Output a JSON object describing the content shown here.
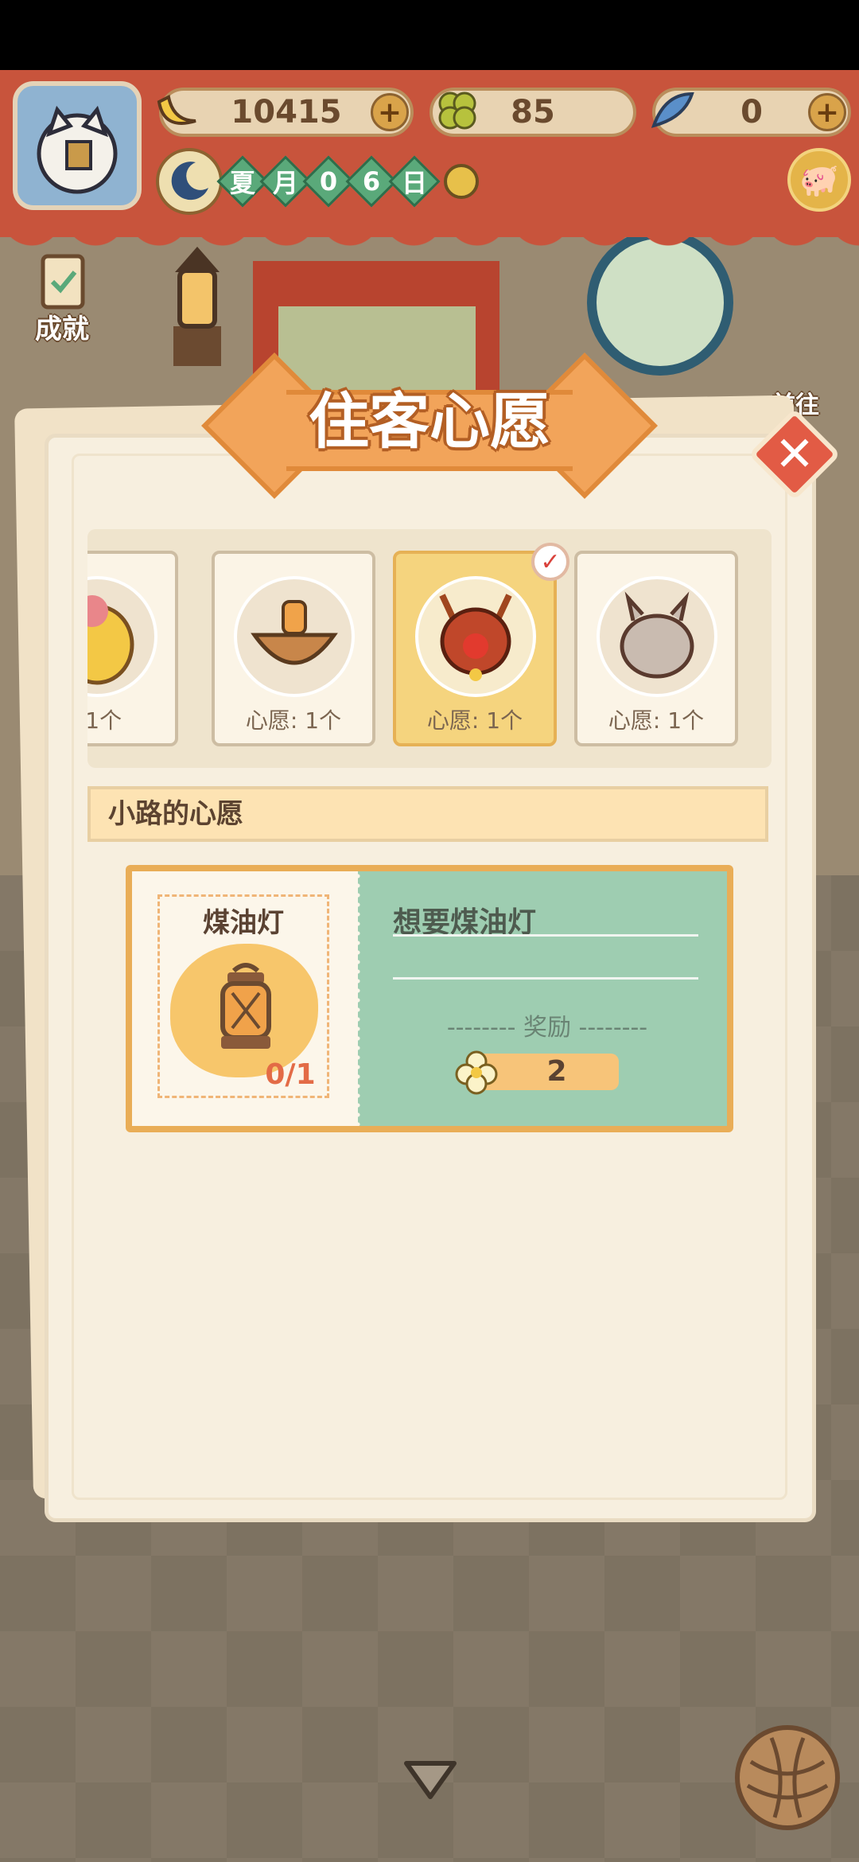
{
  "hud": {
    "bananas": "10415",
    "clovers": "85",
    "fish": "0",
    "season_chars": [
      "夏",
      "月",
      "0",
      "6",
      "日"
    ],
    "achievement_label": "成就",
    "goto_label": "前往"
  },
  "icons": {
    "banana": "banana-icon",
    "clover": "clover-icon",
    "fish": "fish-icon",
    "moon": "moon-icon",
    "sun": "sun-icon",
    "piggy": "piggy-bank-icon",
    "close": "close-icon",
    "check": "check-icon",
    "lantern": "lantern-icon",
    "flower": "flower-icon",
    "down": "chevron-down-icon",
    "yarn": "yarn-ball-icon"
  },
  "dialog": {
    "title": "住客心愿",
    "guests": [
      {
        "caption": ": 1个",
        "selected": false
      },
      {
        "caption": "心愿: 1个",
        "selected": false
      },
      {
        "caption": "心愿: 1个",
        "selected": true
      },
      {
        "caption": "心愿: 1个",
        "selected": false
      }
    ],
    "wish_header": "小路的心愿",
    "wish": {
      "item_name": "煤油灯",
      "progress": "0/1",
      "title": "想要煤油灯",
      "reward_label": "-------- 奖励 --------",
      "reward_count": "2"
    }
  },
  "colors": {
    "accent_orange": "#f2a45a",
    "close_red": "#e25b45",
    "wish_green": "#9ecdb1",
    "selected_gold": "#f5d47e"
  }
}
